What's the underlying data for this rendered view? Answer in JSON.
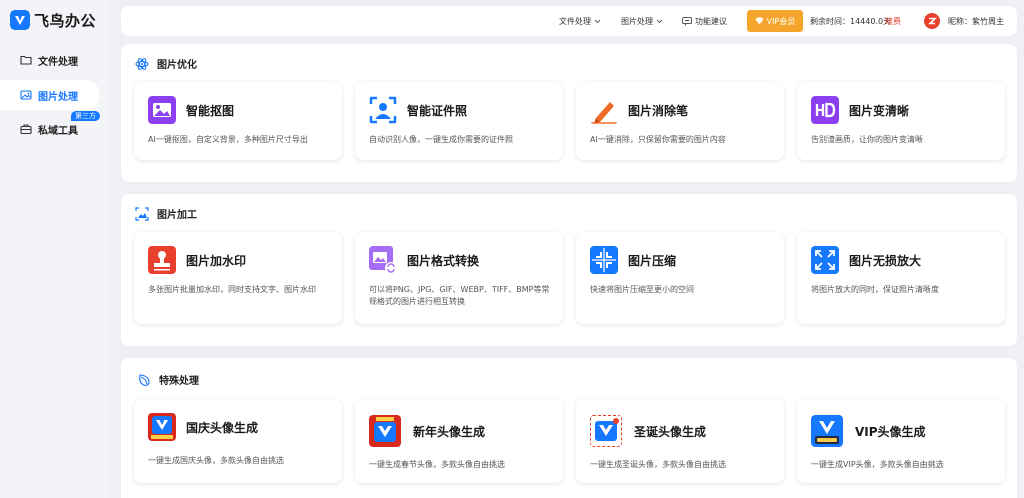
{
  "app": {
    "title": "飞鸟办公"
  },
  "sidebar": {
    "items": [
      {
        "label": "文件处理",
        "icon": "folder-icon"
      },
      {
        "label": "图片处理",
        "icon": "image-icon",
        "active": true
      },
      {
        "label": "私域工具",
        "icon": "briefcase-icon",
        "badge": "第三方"
      }
    ]
  },
  "topbar": {
    "file_menu": "文件处理",
    "image_menu": "图片处理",
    "feedback": "功能建议",
    "vip_button": "VIP会员",
    "remaining": "剩余时间：14440.0天",
    "renew": "续费",
    "nickname": "昵称：紫竹周主"
  },
  "colors": {
    "accent": "#1677ff",
    "vip": "#f6a52c",
    "renew": "#e8402c"
  },
  "sections": [
    {
      "title": "图片优化",
      "icon": "atom-icon",
      "cards": [
        {
          "title": "智能抠图",
          "desc": "AI一键抠图，自定义背景，多种图片尺寸导出",
          "icon": "cutout-icon"
        },
        {
          "title": "智能证件照",
          "desc": "自动识别人像，一键生成你需要的证件照",
          "icon": "id-photo-icon"
        },
        {
          "title": "图片消除笔",
          "desc": "AI一键消除，只保留你需要的图片内容",
          "icon": "eraser-pen-icon"
        },
        {
          "title": "图片变清晰",
          "desc": "告别渣画质，让你的图片变清晰",
          "icon": "hd-icon"
        }
      ]
    },
    {
      "title": "图片加工",
      "icon": "image-edit-icon",
      "cards": [
        {
          "title": "图片加水印",
          "desc": "多张图片批量加水印，同时支持文字、图片水印",
          "icon": "watermark-icon"
        },
        {
          "title": "图片格式转换",
          "desc": "可以将PNG、JPG、GIF、WEBP、TIFF、BMP等常规格式的图片进行相互转换",
          "icon": "format-convert-icon"
        },
        {
          "title": "图片压缩",
          "desc": "快速将图片压缩至更小的空间",
          "icon": "compress-icon"
        },
        {
          "title": "图片无损放大",
          "desc": "将图片放大的同时，保证照片清晰度",
          "icon": "enlarge-icon"
        }
      ]
    },
    {
      "title": "特殊处理",
      "icon": "special-icon",
      "cards": [
        {
          "title": "国庆头像生成",
          "desc": "一键生成国庆头像，多款头像自由挑选",
          "icon": "national-day-avatar-icon"
        },
        {
          "title": "新年头像生成",
          "desc": "一键生成春节头像，多款头像自由挑选",
          "icon": "new-year-avatar-icon"
        },
        {
          "title": "圣诞头像生成",
          "desc": "一键生成圣诞头像，多款头像自由挑选",
          "icon": "christmas-avatar-icon"
        },
        {
          "title": "VIP头像生成",
          "desc": "一键生成VIP头像，多款头像自由挑选",
          "icon": "vip-avatar-icon"
        }
      ]
    }
  ]
}
